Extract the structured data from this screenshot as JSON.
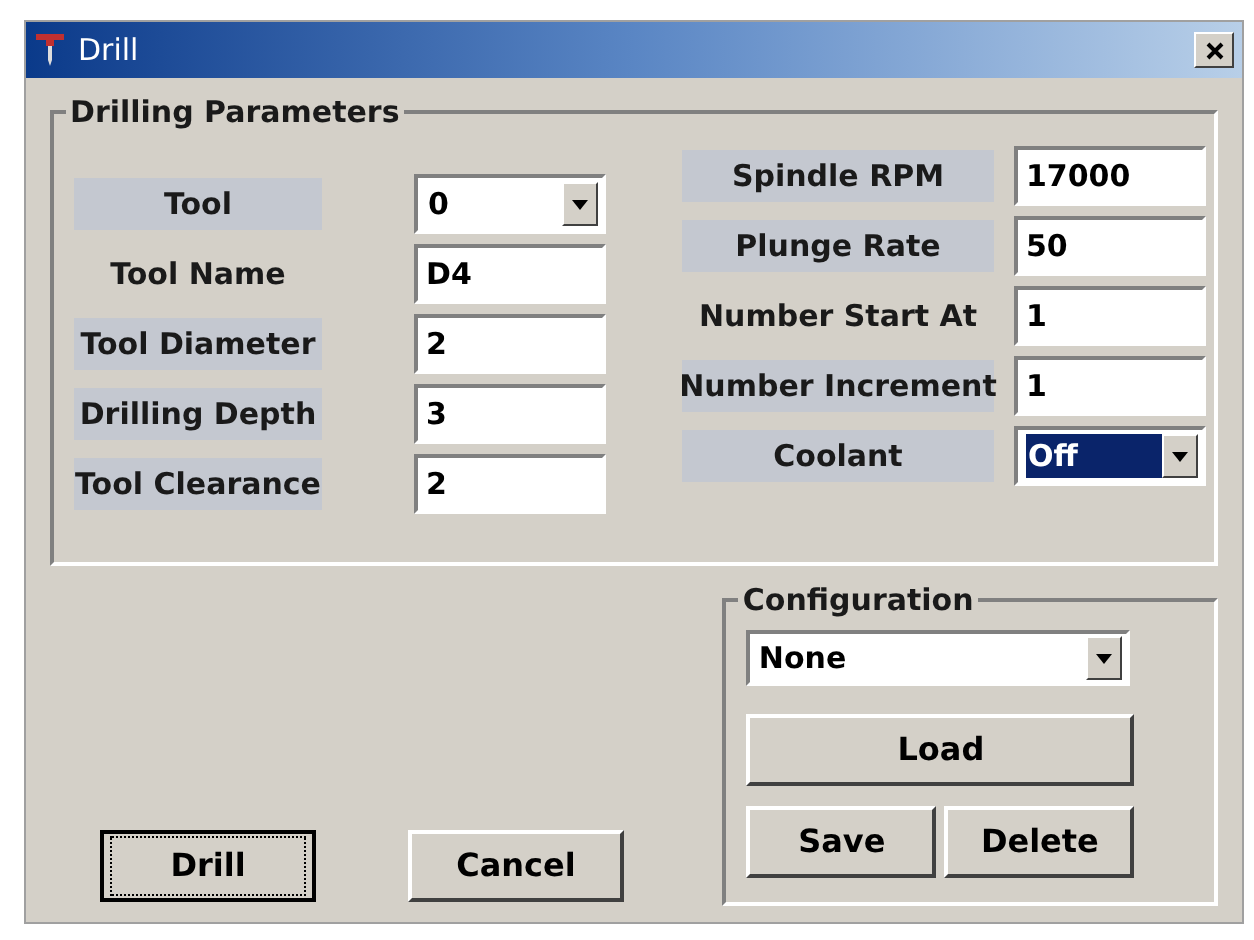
{
  "window": {
    "title": "Drill"
  },
  "drilling_parameters": {
    "title": "Drilling Parameters",
    "left": [
      {
        "label": "Tool",
        "shaded": true,
        "kind": "dropdown",
        "value": "0",
        "highlighted": false
      },
      {
        "label": "Tool Name",
        "shaded": false,
        "kind": "text",
        "value": "D4",
        "highlighted": false
      },
      {
        "label": "Tool Diameter",
        "shaded": true,
        "kind": "text",
        "value": "2",
        "highlighted": false
      },
      {
        "label": "Drilling Depth",
        "shaded": true,
        "kind": "text",
        "value": "3",
        "highlighted": false
      },
      {
        "label": "Tool Clearance",
        "shaded": true,
        "kind": "text",
        "value": "2",
        "highlighted": false
      }
    ],
    "right": [
      {
        "label": "Spindle RPM",
        "shaded": true,
        "kind": "text",
        "value": "17000",
        "highlighted": false
      },
      {
        "label": "Plunge Rate",
        "shaded": true,
        "kind": "text",
        "value": "50",
        "highlighted": false
      },
      {
        "label": "Number Start At",
        "shaded": false,
        "kind": "text",
        "value": "1",
        "highlighted": false
      },
      {
        "label": "Number Increment",
        "shaded": true,
        "kind": "text",
        "value": "1",
        "highlighted": false
      },
      {
        "label": "Coolant",
        "shaded": true,
        "kind": "dropdown",
        "value": "Off",
        "highlighted": true
      }
    ]
  },
  "configuration": {
    "title": "Configuration",
    "value": "None",
    "buttons": [
      "Load",
      "Save",
      "Delete"
    ]
  },
  "buttons": [
    {
      "label": "Drill",
      "focused": true
    },
    {
      "label": "Cancel",
      "focused": false
    }
  ]
}
